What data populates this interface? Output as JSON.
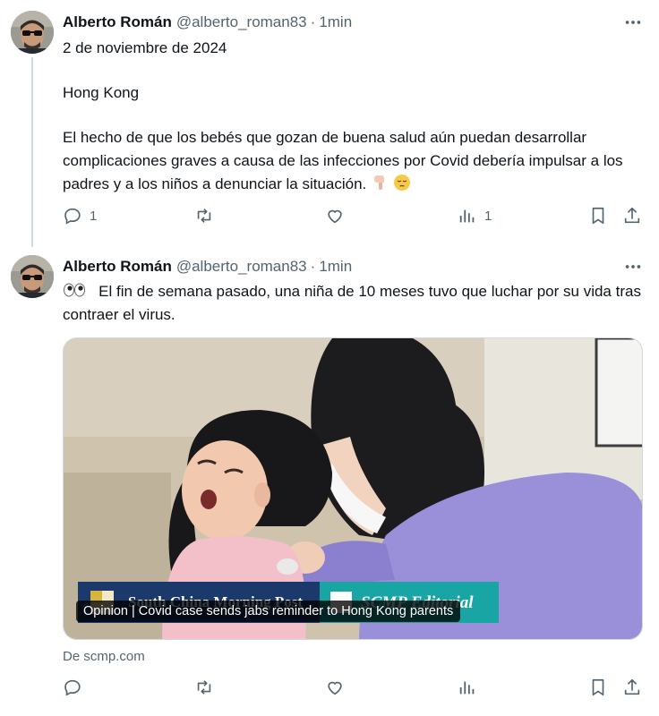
{
  "tweets": [
    {
      "author_name": "Alberto Román",
      "handle": "@alberto_roman83",
      "separator": "·",
      "time": "1min",
      "date_text": "2 de noviembre de 2024",
      "location_text": "Hong Kong",
      "body_text": "El hecho de que los bebés que gozan de buena salud aún puedan desarrollar complicaciones graves a causa de las infecciones por Covid debería impulsar a los padres y a los niños a denunciar la situación.",
      "emojis": [
        "backhand-index-pointing-down",
        "pensive-face"
      ],
      "actions": {
        "reply_count": "1",
        "retweet_count": "",
        "like_count": "",
        "views_count": "1"
      }
    },
    {
      "author_name": "Alberto Román",
      "handle": "@alberto_roman83",
      "separator": "·",
      "time": "1min",
      "emoji_prefix": "eyes",
      "body_text": "El fin de semana pasado, una niña de 10 meses tuvo que luchar por su vida tras contraer el virus.",
      "card": {
        "brand_left": "South China Morning Post",
        "brand_right": "SCMP Editorial",
        "caption": "Opinion | Covid case sends jabs reminder to Hong Kong parents",
        "domain_text": "De scmp.com"
      },
      "actions": {
        "reply_count": "",
        "retweet_count": "",
        "like_count": "",
        "views_count": ""
      }
    }
  ],
  "icons": [
    "avatar",
    "more-icon",
    "reply-icon",
    "retweet-icon",
    "like-icon",
    "views-icon",
    "bookmark-icon",
    "share-icon"
  ],
  "colors": {
    "text": "#0f1419",
    "secondary": "#536471",
    "border": "#cfd9de",
    "scmp_blue": "#1b3a6b",
    "scmp_teal": "#1aa5a5"
  }
}
